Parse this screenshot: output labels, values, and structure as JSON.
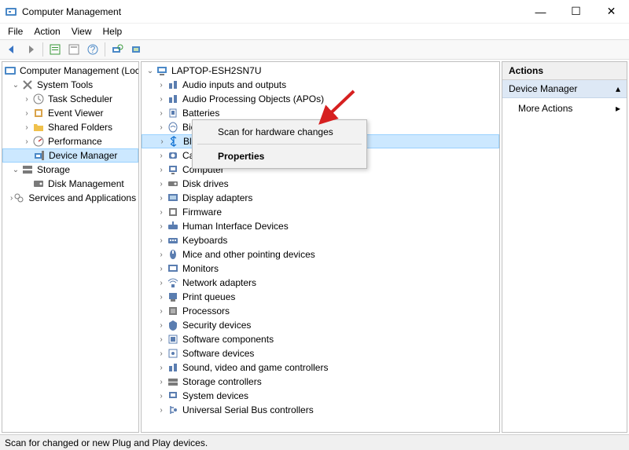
{
  "window": {
    "title": "Computer Management",
    "min": "—",
    "max": "☐",
    "close": "✕"
  },
  "menubar": [
    "File",
    "Action",
    "View",
    "Help"
  ],
  "left_tree": {
    "root": "Computer Management (Local)",
    "nodes": [
      {
        "label": "System Tools",
        "children": [
          {
            "label": "Task Scheduler"
          },
          {
            "label": "Event Viewer"
          },
          {
            "label": "Shared Folders"
          },
          {
            "label": "Performance"
          },
          {
            "label": "Device Manager",
            "selected": true
          }
        ]
      },
      {
        "label": "Storage",
        "children": [
          {
            "label": "Disk Management"
          }
        ]
      },
      {
        "label": "Services and Applications"
      }
    ]
  },
  "center_tree": {
    "root": "LAPTOP-ESH2SN7U",
    "items": [
      "Audio inputs and outputs",
      "Audio Processing Objects (APOs)",
      "Batteries",
      "Biometric devices",
      "Bluetooth",
      "Cameras",
      "Computer",
      "Disk drives",
      "Display adapters",
      "Firmware",
      "Human Interface Devices",
      "Keyboards",
      "Mice and other pointing devices",
      "Monitors",
      "Network adapters",
      "Print queues",
      "Processors",
      "Security devices",
      "Software components",
      "Software devices",
      "Sound, video and game controllers",
      "Storage controllers",
      "System devices",
      "Universal Serial Bus controllers"
    ],
    "selected_index": 4
  },
  "context_menu": {
    "items": [
      {
        "label": "Scan for hardware changes",
        "bold": false
      },
      {
        "label": "Properties",
        "bold": true
      }
    ]
  },
  "actions_pane": {
    "header": "Actions",
    "section": "Device Manager",
    "more": "More Actions"
  },
  "status": "Scan for changed or new Plug and Play devices.",
  "icon_colors": {
    "audio": "#5a7db0",
    "apo": "#5a7db0",
    "battery": "#5a7db0",
    "biometric": "#5a7db0",
    "bluetooth": "#0a6ed1",
    "camera": "#5a7db0",
    "computer": "#5a7db0",
    "disk": "#7a7a7a",
    "display": "#5a7db0",
    "firmware": "#7a7a7a",
    "hid": "#5a7db0",
    "keyboard": "#5a7db0",
    "mouse": "#5a7db0",
    "monitor": "#5a7db0",
    "network": "#5a7db0",
    "print": "#5a7db0",
    "cpu": "#7a7a7a",
    "security": "#5a7db0",
    "swcomp": "#5a7db0",
    "swdev": "#5a7db0",
    "sound": "#5a7db0",
    "storage": "#7a7a7a",
    "system": "#5a7db0",
    "usb": "#5a7db0"
  }
}
